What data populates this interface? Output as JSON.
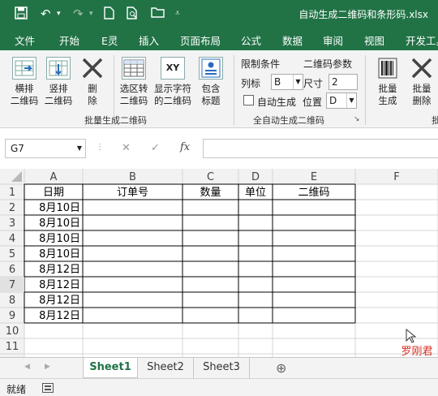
{
  "titlebar": {
    "title": "自动生成二维码和条形码.xlsx",
    "save_icon": "save-icon",
    "undo_icon": "undo-icon",
    "redo_icon": "redo-icon",
    "new_icon": "new-document-icon",
    "preview_icon": "print-preview-icon",
    "open_icon": "open-folder-icon",
    "customize_icon": "customize-toolbar-icon",
    "bg_color": "#217346"
  },
  "tabs": [
    "文件",
    "开始",
    "E灵",
    "插入",
    "页面布局",
    "公式",
    "数据",
    "审阅",
    "视图",
    "开发工具"
  ],
  "ribbon": {
    "btn_horizontal": [
      "横排",
      "二维码"
    ],
    "btn_vertical": [
      "竖排",
      "二维码"
    ],
    "btn_delete": [
      "删",
      "除"
    ],
    "btn_select_convert": [
      "选区转",
      "二维码"
    ],
    "btn_display_char": [
      "显示字符",
      "的二维码"
    ],
    "btn_include_title": [
      "包含",
      "标题"
    ],
    "group_batch": "批量生成二维码",
    "limit_label": "限制条件",
    "params_label": "二维码参数",
    "col_label": "列标",
    "col_value": "B",
    "size_label": "尺寸",
    "size_value": "2",
    "auto_label": "自动生成",
    "pos_label": "位置",
    "pos_value": "D",
    "group_auto": "全自动生成二维码",
    "btn_batch_gen": [
      "批量",
      "生成"
    ],
    "btn_batch_del": [
      "批量",
      "删除"
    ],
    "group_more": "批"
  },
  "formula_bar": {
    "name_box": "G7",
    "cancel": "✕",
    "enter": "✓",
    "fx": "fx",
    "value": ""
  },
  "columns": [
    "A",
    "B",
    "C",
    "D",
    "E",
    "F"
  ],
  "row_numbers": [
    "1",
    "2",
    "3",
    "4",
    "5",
    "6",
    "7",
    "8",
    "9",
    "10",
    "11"
  ],
  "headers": [
    "日期",
    "订单号",
    "数量",
    "单位",
    "二维码"
  ],
  "rows": [
    [
      "8月10日",
      "",
      "",
      "",
      ""
    ],
    [
      "8月10日",
      "",
      "",
      "",
      ""
    ],
    [
      "8月10日",
      "",
      "",
      "",
      ""
    ],
    [
      "8月10日",
      "",
      "",
      "",
      ""
    ],
    [
      "8月12日",
      "",
      "",
      "",
      ""
    ],
    [
      "8月12日",
      "",
      "",
      "",
      ""
    ],
    [
      "8月12日",
      "",
      "",
      "",
      ""
    ],
    [
      "8月12日",
      "",
      "",
      "",
      ""
    ]
  ],
  "watermark": "罗刚君",
  "sheets": [
    "Sheet1",
    "Sheet2",
    "Sheet3"
  ],
  "active_sheet": "Sheet1",
  "add_sheet": "⊕",
  "status": "就绪"
}
